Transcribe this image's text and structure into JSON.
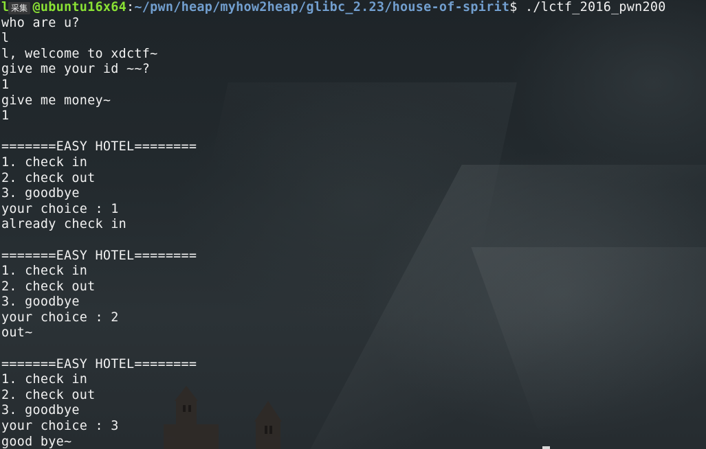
{
  "prompt": {
    "user_host": "l   @ubuntu16x64",
    "path": "~/pwn/heap/myhow2heap/glibc_2.23/house-of-spirit",
    "symbol": "$",
    "command": "./lctf_2016_pwn200"
  },
  "ime_label": "采集",
  "output_lines": [
    "who are u?",
    "l",
    "l, welcome to xdctf~",
    "give me your id ~~?",
    "1",
    "give me money~",
    "1",
    "",
    "=======EASY HOTEL========",
    "1. check in",
    "2. check out",
    "3. goodbye",
    "your choice : 1",
    "already check in",
    "",
    "=======EASY HOTEL========",
    "1. check in",
    "2. check out",
    "3. goodbye",
    "your choice : 2",
    "out~",
    "",
    "=======EASY HOTEL========",
    "1. check in",
    "2. check out",
    "3. goodbye",
    "your choice : 3",
    "good bye~"
  ],
  "colors": {
    "prompt_user": "#8ae234",
    "prompt_path": "#729fcf",
    "text": "#f2f2f2"
  }
}
